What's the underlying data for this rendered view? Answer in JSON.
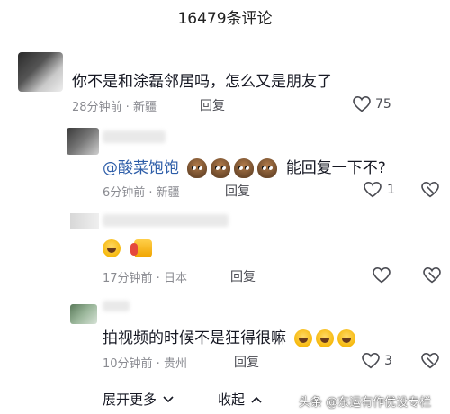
{
  "header": {
    "title": "16479条评论"
  },
  "comments": [
    {
      "username": "",
      "text": "你不是和涂磊邻居吗，怎么又是朋友了",
      "time_location": "28分钟前 · 新疆",
      "reply_label": "回复",
      "likes": "75"
    },
    {
      "username": "",
      "mention": "@酸菜饱饱",
      "text_after": "能回复一下不?",
      "emojis": [
        "poop-emoji",
        "poop-emoji",
        "poop-emoji",
        "poop-emoji"
      ],
      "time_location": "6分钟前 · 新疆",
      "reply_label": "回复",
      "likes": "1"
    },
    {
      "username": "",
      "emojis": [
        "laugh-cry-emoji",
        "thumbs-up-emoji"
      ],
      "time_location": "17分钟前 · 日本",
      "reply_label": "回复",
      "likes": ""
    },
    {
      "username": "",
      "text": "拍视频的时候不是狂得很嘛",
      "emojis": [
        "laugh-cry-emoji",
        "laugh-cry-emoji",
        "laugh-cry-emoji"
      ],
      "time_location": "10分钟前 · 贵州",
      "reply_label": "回复",
      "likes": "3"
    }
  ],
  "footer": {
    "expand_label": "展开更多",
    "collapse_label": "收起",
    "watermark": "头条 @东运有作优设专栏"
  },
  "icons": {
    "like": "heart-outline-icon",
    "expand": "chevron-down-icon",
    "collapse": "chevron-up-icon"
  },
  "colors": {
    "mention": "#2d5da8",
    "meta": "#8a8b91"
  }
}
